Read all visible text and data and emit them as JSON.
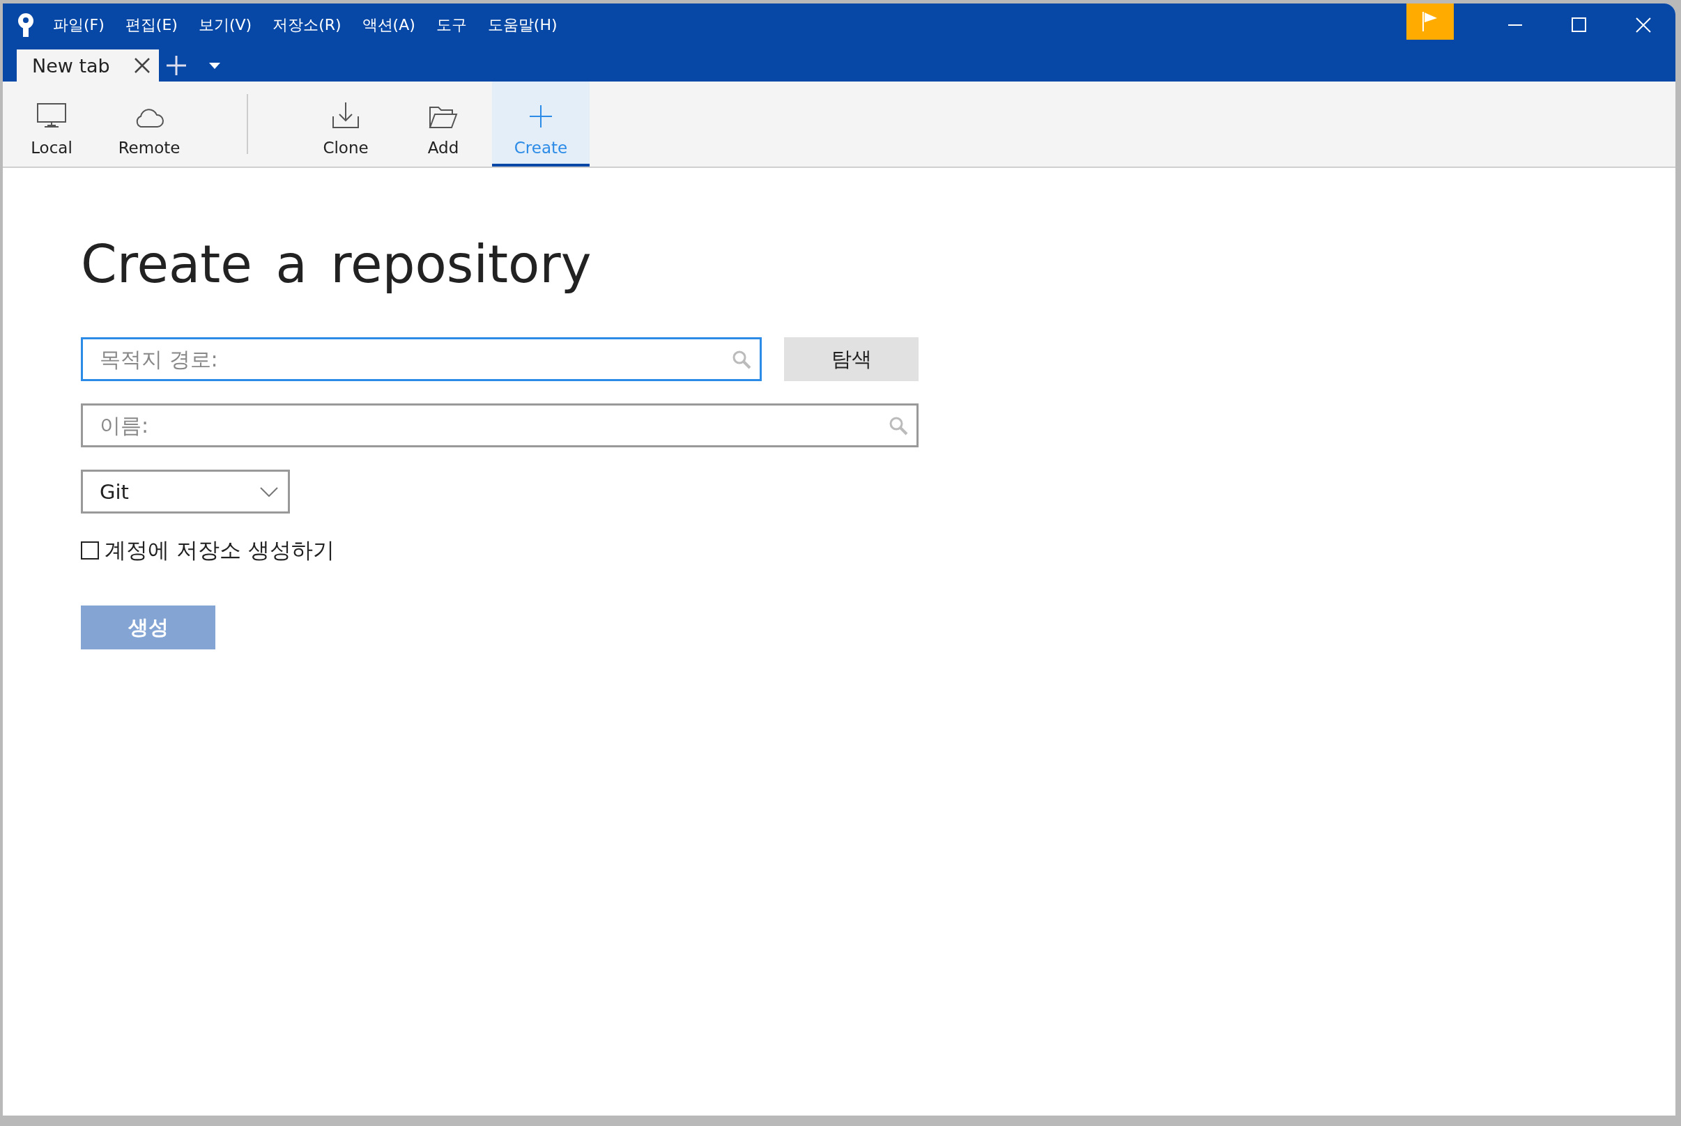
{
  "menu": [
    "파일(F)",
    "편집(E)",
    "보기(V)",
    "저장소(R)",
    "액션(A)",
    "도구",
    "도움말(H)"
  ],
  "tabs": [
    {
      "label": "New tab",
      "selected": true
    }
  ],
  "toolbar": [
    {
      "label": "Local",
      "kind": "monitor",
      "selected": false
    },
    {
      "label": "Remote",
      "kind": "cloud",
      "selected": false
    },
    {
      "label": "Clone",
      "kind": "download",
      "selected": false
    },
    {
      "label": "Add",
      "kind": "folder",
      "selected": false
    },
    {
      "label": "Create",
      "kind": "plus",
      "selected": true
    }
  ],
  "heading": "Create a repository",
  "destination_field": {
    "placeholder": "목적지 경로:",
    "focused": true
  },
  "browse_button": "탐색",
  "name_field": {
    "placeholder": "이름:",
    "focused": false
  },
  "vcs_dropdown": {
    "value": "Git"
  },
  "account_checkbox": {
    "label": "계정에 저장소 생성하기",
    "checked": false
  },
  "create_button": {
    "label": "생성",
    "disabled": true
  }
}
